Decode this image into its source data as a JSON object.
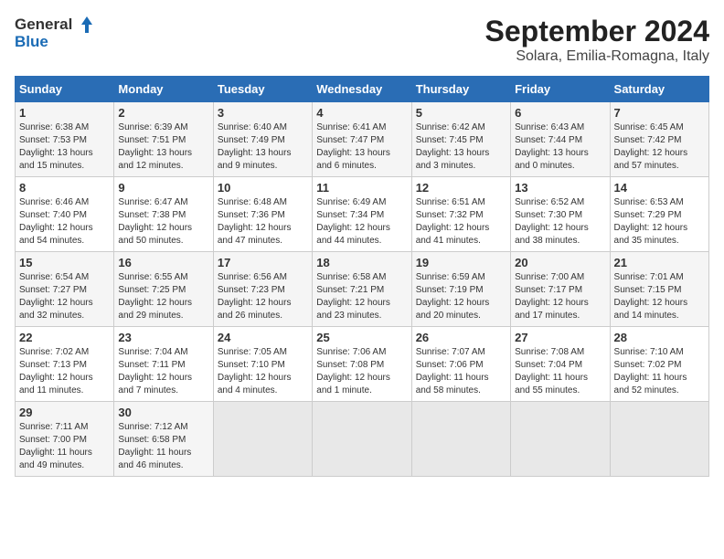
{
  "logo": {
    "line1": "General",
    "line2": "Blue"
  },
  "title": "September 2024",
  "location": "Solara, Emilia-Romagna, Italy",
  "days_of_week": [
    "Sunday",
    "Monday",
    "Tuesday",
    "Wednesday",
    "Thursday",
    "Friday",
    "Saturday"
  ],
  "weeks": [
    [
      {
        "day": "1",
        "info": "Sunrise: 6:38 AM\nSunset: 7:53 PM\nDaylight: 13 hours\nand 15 minutes."
      },
      {
        "day": "2",
        "info": "Sunrise: 6:39 AM\nSunset: 7:51 PM\nDaylight: 13 hours\nand 12 minutes."
      },
      {
        "day": "3",
        "info": "Sunrise: 6:40 AM\nSunset: 7:49 PM\nDaylight: 13 hours\nand 9 minutes."
      },
      {
        "day": "4",
        "info": "Sunrise: 6:41 AM\nSunset: 7:47 PM\nDaylight: 13 hours\nand 6 minutes."
      },
      {
        "day": "5",
        "info": "Sunrise: 6:42 AM\nSunset: 7:45 PM\nDaylight: 13 hours\nand 3 minutes."
      },
      {
        "day": "6",
        "info": "Sunrise: 6:43 AM\nSunset: 7:44 PM\nDaylight: 13 hours\nand 0 minutes."
      },
      {
        "day": "7",
        "info": "Sunrise: 6:45 AM\nSunset: 7:42 PM\nDaylight: 12 hours\nand 57 minutes."
      }
    ],
    [
      {
        "day": "8",
        "info": "Sunrise: 6:46 AM\nSunset: 7:40 PM\nDaylight: 12 hours\nand 54 minutes."
      },
      {
        "day": "9",
        "info": "Sunrise: 6:47 AM\nSunset: 7:38 PM\nDaylight: 12 hours\nand 50 minutes."
      },
      {
        "day": "10",
        "info": "Sunrise: 6:48 AM\nSunset: 7:36 PM\nDaylight: 12 hours\nand 47 minutes."
      },
      {
        "day": "11",
        "info": "Sunrise: 6:49 AM\nSunset: 7:34 PM\nDaylight: 12 hours\nand 44 minutes."
      },
      {
        "day": "12",
        "info": "Sunrise: 6:51 AM\nSunset: 7:32 PM\nDaylight: 12 hours\nand 41 minutes."
      },
      {
        "day": "13",
        "info": "Sunrise: 6:52 AM\nSunset: 7:30 PM\nDaylight: 12 hours\nand 38 minutes."
      },
      {
        "day": "14",
        "info": "Sunrise: 6:53 AM\nSunset: 7:29 PM\nDaylight: 12 hours\nand 35 minutes."
      }
    ],
    [
      {
        "day": "15",
        "info": "Sunrise: 6:54 AM\nSunset: 7:27 PM\nDaylight: 12 hours\nand 32 minutes."
      },
      {
        "day": "16",
        "info": "Sunrise: 6:55 AM\nSunset: 7:25 PM\nDaylight: 12 hours\nand 29 minutes."
      },
      {
        "day": "17",
        "info": "Sunrise: 6:56 AM\nSunset: 7:23 PM\nDaylight: 12 hours\nand 26 minutes."
      },
      {
        "day": "18",
        "info": "Sunrise: 6:58 AM\nSunset: 7:21 PM\nDaylight: 12 hours\nand 23 minutes."
      },
      {
        "day": "19",
        "info": "Sunrise: 6:59 AM\nSunset: 7:19 PM\nDaylight: 12 hours\nand 20 minutes."
      },
      {
        "day": "20",
        "info": "Sunrise: 7:00 AM\nSunset: 7:17 PM\nDaylight: 12 hours\nand 17 minutes."
      },
      {
        "day": "21",
        "info": "Sunrise: 7:01 AM\nSunset: 7:15 PM\nDaylight: 12 hours\nand 14 minutes."
      }
    ],
    [
      {
        "day": "22",
        "info": "Sunrise: 7:02 AM\nSunset: 7:13 PM\nDaylight: 12 hours\nand 11 minutes."
      },
      {
        "day": "23",
        "info": "Sunrise: 7:04 AM\nSunset: 7:11 PM\nDaylight: 12 hours\nand 7 minutes."
      },
      {
        "day": "24",
        "info": "Sunrise: 7:05 AM\nSunset: 7:10 PM\nDaylight: 12 hours\nand 4 minutes."
      },
      {
        "day": "25",
        "info": "Sunrise: 7:06 AM\nSunset: 7:08 PM\nDaylight: 12 hours\nand 1 minute."
      },
      {
        "day": "26",
        "info": "Sunrise: 7:07 AM\nSunset: 7:06 PM\nDaylight: 11 hours\nand 58 minutes."
      },
      {
        "day": "27",
        "info": "Sunrise: 7:08 AM\nSunset: 7:04 PM\nDaylight: 11 hours\nand 55 minutes."
      },
      {
        "day": "28",
        "info": "Sunrise: 7:10 AM\nSunset: 7:02 PM\nDaylight: 11 hours\nand 52 minutes."
      }
    ],
    [
      {
        "day": "29",
        "info": "Sunrise: 7:11 AM\nSunset: 7:00 PM\nDaylight: 11 hours\nand 49 minutes."
      },
      {
        "day": "30",
        "info": "Sunrise: 7:12 AM\nSunset: 6:58 PM\nDaylight: 11 hours\nand 46 minutes."
      },
      {
        "day": "",
        "info": ""
      },
      {
        "day": "",
        "info": ""
      },
      {
        "day": "",
        "info": ""
      },
      {
        "day": "",
        "info": ""
      },
      {
        "day": "",
        "info": ""
      }
    ]
  ]
}
